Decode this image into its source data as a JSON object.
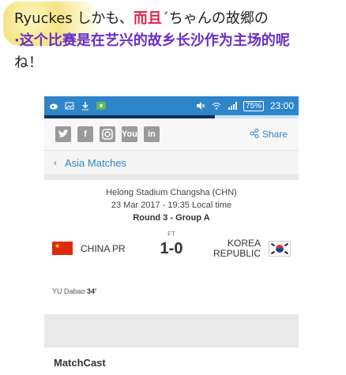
{
  "caption": {
    "line1_prefix": "Ryuckes しかも、",
    "line1_highlight": "而且",
    "line1_suffix": "´ちゃんの故郷の",
    "line2": "·这个比赛是在艺兴的故乡长沙作为主场的呢",
    "line3": "ね！"
  },
  "statusbar": {
    "battery": "75%",
    "time": "23:00"
  },
  "page_progress": 0.67,
  "social": {
    "icons": [
      "twitter-icon",
      "facebook-icon",
      "instagram-icon",
      "youtube-icon",
      "linkedin-icon"
    ],
    "youtube_label": "You",
    "linkedin_label": "in",
    "facebook_label": "f",
    "share_label": "Share"
  },
  "breadcrumb": {
    "label": "Asia Matches"
  },
  "match": {
    "stadium": "Helong Stadium Changsha (CHN)",
    "datetime": "23 Mar 2017 - 19:35 Local time",
    "round": "Round 3 - Group A",
    "status": "FT",
    "home_team": "CHINA PR",
    "score": "1-0",
    "away_team_line1": "KOREA",
    "away_team_line2": "REPUBLIC",
    "goal_player": "YU Dabao",
    "goal_minute": "34'"
  },
  "section": {
    "matchcast": "MatchCast"
  },
  "colors": {
    "status_blue": "#2e86c9",
    "progress_navy": "#0b2d5a",
    "caption_purple": "#6a2fc8",
    "caption_red": "#e5254a"
  }
}
